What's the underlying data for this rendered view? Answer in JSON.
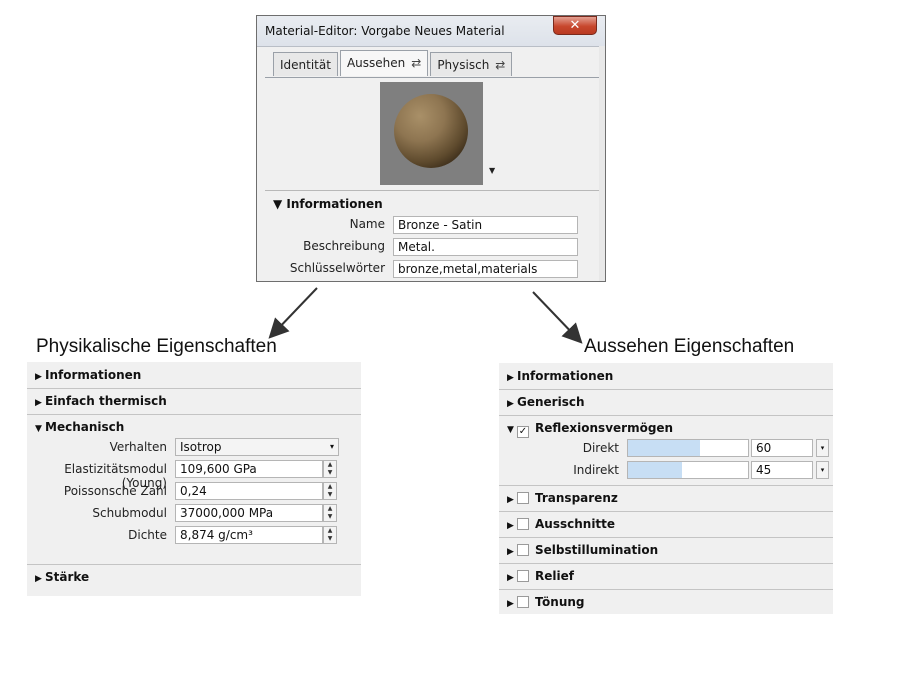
{
  "dialog": {
    "title": "Material-Editor: Vorgabe Neues Material",
    "close_label": "✕",
    "tabs": [
      {
        "label": "Identität"
      },
      {
        "label": "Aussehen"
      },
      {
        "label": "Physisch"
      }
    ],
    "swap_icon": "⇄",
    "info_header": "▼ Informationen",
    "fields": [
      {
        "label": "Name",
        "value": "Bronze - Satin"
      },
      {
        "label": "Beschreibung",
        "value": "Metal."
      },
      {
        "label": "Schlüsselwörter",
        "value": "bronze,metal,materials"
      }
    ]
  },
  "captions": {
    "left": "Physikalische Eigenschaften",
    "right": "Aussehen Eigenschaften"
  },
  "physical": {
    "sections": [
      "Informationen",
      "Einfach thermisch",
      "Mechanisch",
      "Stärke"
    ],
    "props": [
      {
        "label": "Verhalten",
        "value": "Isotrop"
      },
      {
        "label": "Elastizitätsmodul (Young)",
        "value": "109,600 GPa"
      },
      {
        "label": "Poissonsche Zahl",
        "value": "0,24"
      },
      {
        "label": "Schubmodul",
        "value": "37000,000 MPa"
      },
      {
        "label": "Dichte",
        "value": "8,874 g/cm³"
      }
    ]
  },
  "appearance": {
    "sections": [
      "Informationen",
      "Generisch",
      "Reflexionsvermögen",
      "Transparenz",
      "Ausschnitte",
      "Selbstillumination",
      "Relief",
      "Tönung"
    ],
    "reflect": [
      {
        "label": "Direkt",
        "value": "60",
        "fill": 0.6
      },
      {
        "label": "Indirekt",
        "value": "45",
        "fill": 0.45
      }
    ],
    "check": "✓"
  },
  "icons": {
    "collapsed": "▶",
    "expanded": "▼",
    "dropdown": "▾",
    "spin_up": "▲",
    "spin_down": "▼"
  }
}
